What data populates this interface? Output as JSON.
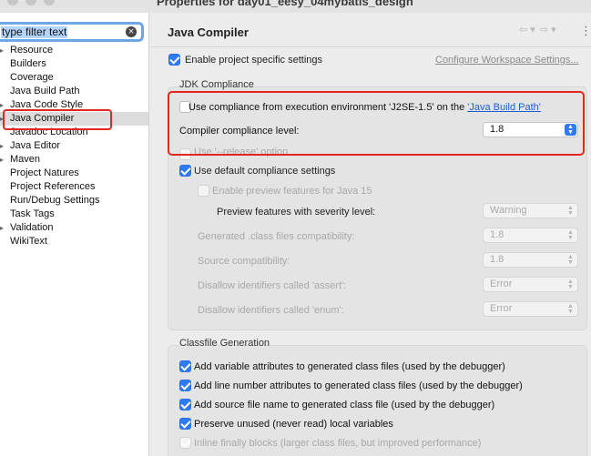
{
  "window": {
    "title": "Properties for day01_eesy_04mybatis_design"
  },
  "sidebar": {
    "filter_text": "type filter text",
    "clear_glyph": "×",
    "items": [
      {
        "label": "Resource",
        "expandable": true
      },
      {
        "label": "Builders",
        "expandable": false
      },
      {
        "label": "Coverage",
        "expandable": false
      },
      {
        "label": "Java Build Path",
        "expandable": false
      },
      {
        "label": "Java Code Style",
        "expandable": true
      },
      {
        "label": "Java Compiler",
        "expandable": true,
        "selected": true
      },
      {
        "label": "Javadoc Location",
        "expandable": false
      },
      {
        "label": "Java Editor",
        "expandable": true
      },
      {
        "label": "Maven",
        "expandable": true
      },
      {
        "label": "Project Natures",
        "expandable": false
      },
      {
        "label": "Project References",
        "expandable": false
      },
      {
        "label": "Run/Debug Settings",
        "expandable": false
      },
      {
        "label": "Task Tags",
        "expandable": false
      },
      {
        "label": "Validation",
        "expandable": true
      },
      {
        "label": "WikiText",
        "expandable": false
      }
    ]
  },
  "main": {
    "title": "Java Compiler",
    "nav": {
      "back": "⇦ ▾",
      "forward": "⇨ ▾",
      "menu": "⋮"
    },
    "enable_project_label": "Enable project specific settings",
    "enable_project_checked": true,
    "configure_link": "Configure Workspace Settings...",
    "jdk": {
      "title": "JDK Compliance",
      "use_exec_prefix": "Use compliance from execution environment 'J2SE-1.5' on the ",
      "use_exec_link": "'Java Build Path'",
      "use_exec_checked": false,
      "compliance_label": "Compiler compliance level:",
      "compliance_value": "1.8",
      "release_label": "Use '--release' option",
      "default_compliance_label": "Use default compliance settings",
      "default_compliance_checked": true,
      "preview_label": "Enable preview features for Java 15",
      "severity_label": "Preview features with severity level:",
      "severity_value": "Warning",
      "classfiles_label": "Generated .class files compatibility:",
      "classfiles_value": "1.8",
      "source_label": "Source compatibility:",
      "source_value": "1.8",
      "assert_label": "Disallow identifiers called 'assert':",
      "assert_value": "Error",
      "enum_label": "Disallow identifiers called 'enum':",
      "enum_value": "Error"
    },
    "classfile": {
      "title": "Classfile Generation",
      "options": [
        {
          "label": "Add variable attributes to generated class files (used by the debugger)",
          "checked": true
        },
        {
          "label": "Add line number attributes to generated class files (used by the debugger)",
          "checked": true
        },
        {
          "label": "Add source file name to generated class file (used by the debugger)",
          "checked": true
        },
        {
          "label": "Preserve unused (never read) local variables",
          "checked": true
        },
        {
          "label": "Inline finally blocks (larger class files, but improved performance)",
          "checked": true
        }
      ]
    }
  },
  "colors": {
    "accent": "#2f7bf5",
    "highlight_box": "#e0281e",
    "link": "#1a5fd1"
  }
}
